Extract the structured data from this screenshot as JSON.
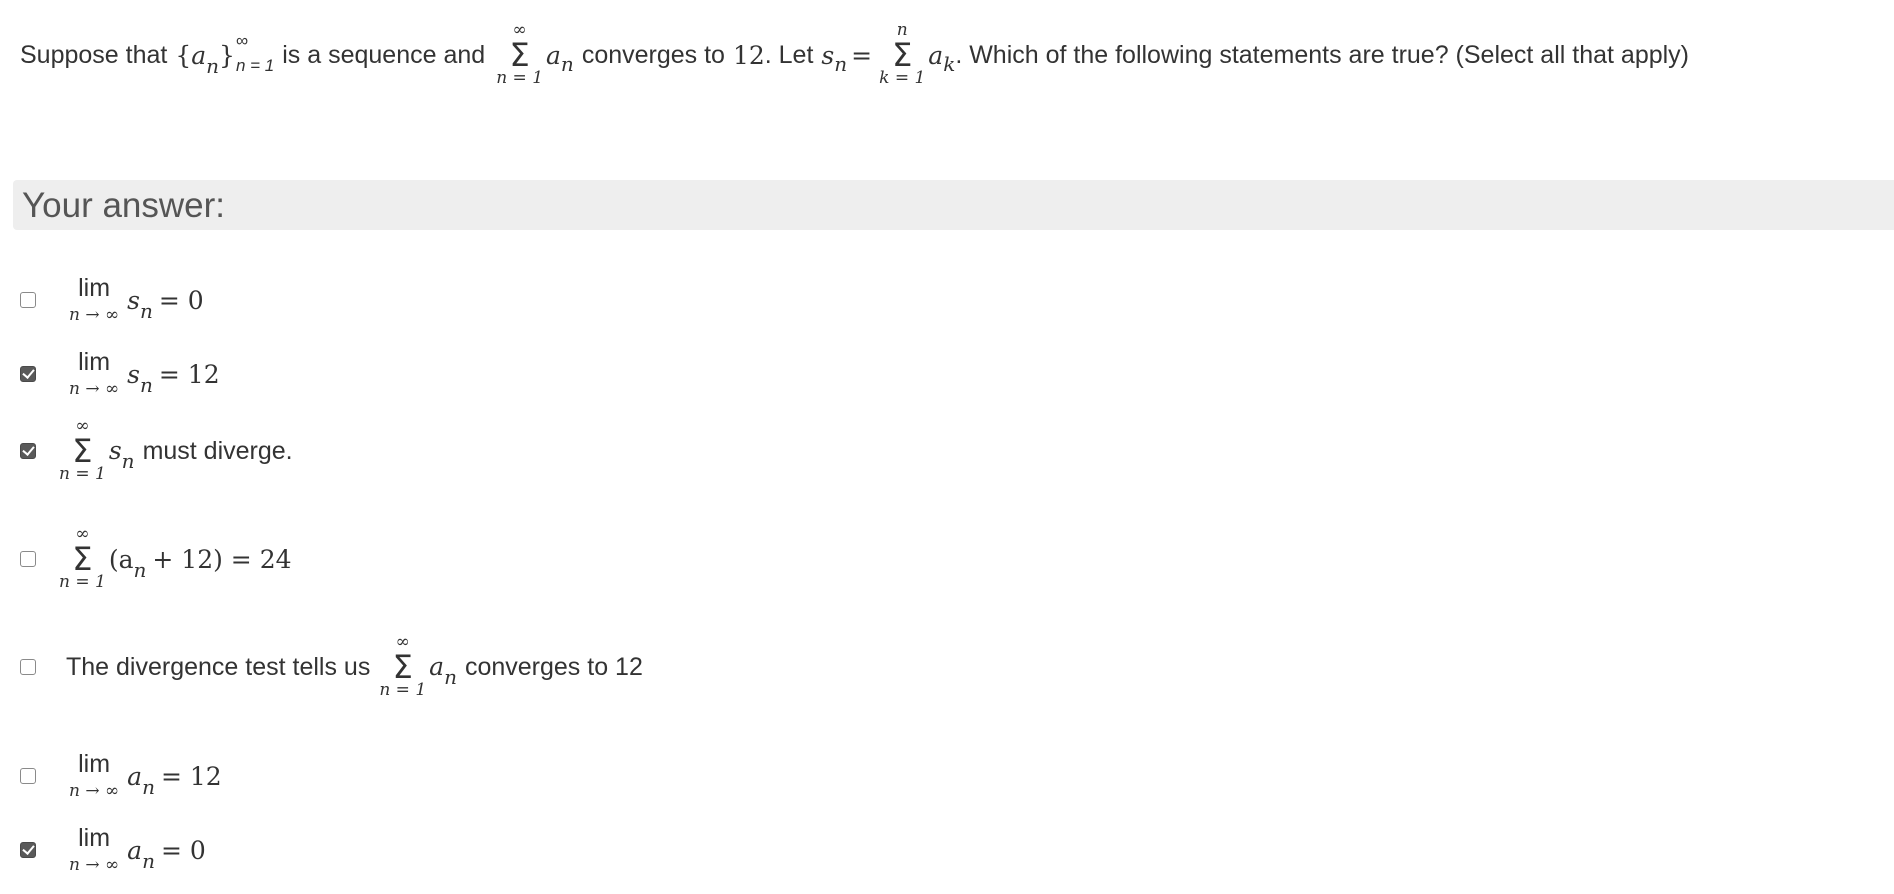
{
  "question": {
    "prefix": "Suppose that",
    "sequence_open": "{",
    "sequence_var": "a",
    "sequence_sub": "n",
    "sequence_close": "}",
    "sequence_sup": "∞",
    "sequence_from": "n = 1",
    "middle": "is a sequence and",
    "sum1_top": "∞",
    "sum1_bottom": "n = 1",
    "sum1_term": "a",
    "sum1_sub": "n",
    "converges_text": "converges to",
    "converges_value": "12",
    "let_text": ". Let",
    "s_var": "s",
    "s_sub": "n",
    "equals": "=",
    "sum2_top": "n",
    "sum2_bottom": "k = 1",
    "sum2_term": "a",
    "sum2_sub": "k",
    "suffix": ". Which of the following statements are true? (Select all that apply)"
  },
  "answer_header": "Your answer:",
  "options": [
    {
      "checked": false,
      "lim": "lim",
      "under": "n → ∞",
      "var": "s",
      "sub": "n",
      "rest": "= 0"
    },
    {
      "checked": true,
      "lim": "lim",
      "under": "n → ∞",
      "var": "s",
      "sub": "n",
      "rest": "= 12"
    },
    {
      "checked": true,
      "sum_top": "∞",
      "sum_bottom": "n = 1",
      "var": "s",
      "sub": "n",
      "rest": "must diverge."
    },
    {
      "checked": false,
      "sum_top": "∞",
      "sum_bottom": "n = 1",
      "open": "(a",
      "sub": "n",
      "rest": "+ 12) = 24"
    },
    {
      "checked": false,
      "prefix": "The divergence test tells us",
      "sum_top": "∞",
      "sum_bottom": "n = 1",
      "var": "a",
      "sub": "n",
      "rest": "converges to 12"
    },
    {
      "checked": false,
      "lim": "lim",
      "under": "n → ∞",
      "var": "a",
      "sub": "n",
      "rest": "= 12"
    },
    {
      "checked": true,
      "lim": "lim",
      "under": "n → ∞",
      "var": "a",
      "sub": "n",
      "rest": "= 0"
    }
  ]
}
